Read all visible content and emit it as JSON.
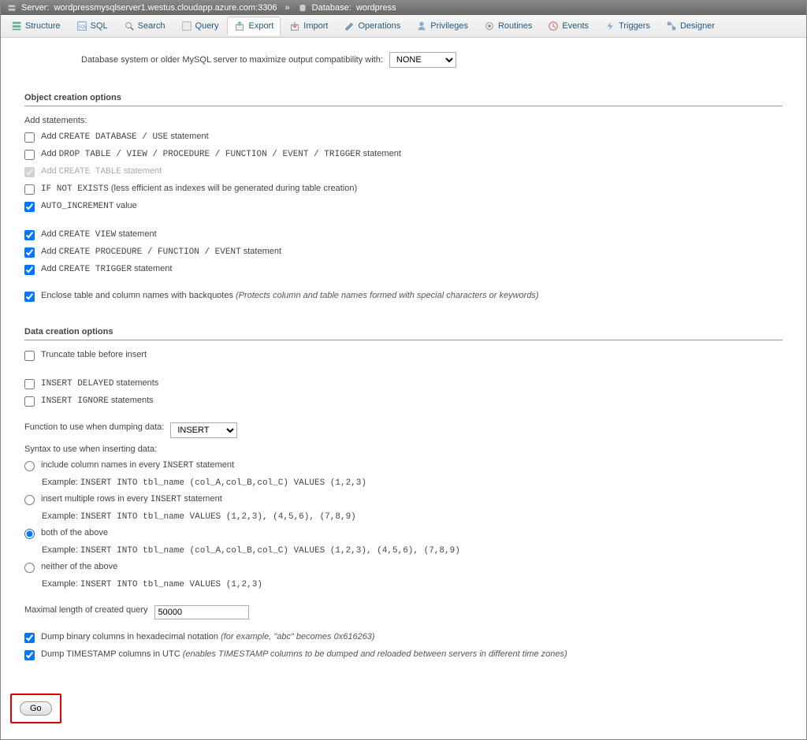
{
  "titlebar": {
    "server_label": "Server:",
    "server_value": "wordpressmysqlserver1.westus.cloudapp.azure.com:3306",
    "db_label": "Database:",
    "db_value": "wordpress"
  },
  "menu": {
    "structure": "Structure",
    "sql": "SQL",
    "search": "Search",
    "query": "Query",
    "export": "Export",
    "import": "Import",
    "operations": "Operations",
    "privileges": "Privileges",
    "routines": "Routines",
    "events": "Events",
    "triggers": "Triggers",
    "designer": "Designer"
  },
  "compat": {
    "label": "Database system or older MySQL server to maximize output compatibility with:",
    "value": "NONE"
  },
  "sections": {
    "object": "Object creation options",
    "data": "Data creation options"
  },
  "object": {
    "add_statements": "Add statements:",
    "create_db_pre": "Add ",
    "create_db_code": "CREATE DATABASE / USE",
    "create_db_post": " statement",
    "drop_pre": "Add ",
    "drop_code": "DROP TABLE / VIEW / PROCEDURE / FUNCTION / EVENT / TRIGGER",
    "drop_post": " statement",
    "create_table_pre": "Add ",
    "create_table_code": "CREATE TABLE",
    "create_table_post": " statement",
    "ifnotexists_code": "IF NOT EXISTS",
    "ifnotexists_post": " (less efficient as indexes will be generated during table creation)",
    "autoinc_code": "AUTO_INCREMENT",
    "autoinc_post": " value",
    "create_view_pre": "Add ",
    "create_view_code": "CREATE VIEW",
    "create_view_post": " statement",
    "create_proc_pre": "Add ",
    "create_proc_code": "CREATE PROCEDURE / FUNCTION / EVENT",
    "create_proc_post": " statement",
    "create_trig_pre": "Add ",
    "create_trig_code": "CREATE TRIGGER",
    "create_trig_post": " statement",
    "backquotes": "Enclose table and column names with backquotes ",
    "backquotes_note": "(Protects column and table names formed with special characters or keywords)"
  },
  "data": {
    "truncate": "Truncate table before insert",
    "delayed_code": "INSERT DELAYED",
    "delayed_post": " statements",
    "ignore_code": "INSERT IGNORE",
    "ignore_post": " statements",
    "func_label": "Function to use when dumping data:",
    "func_value": "INSERT",
    "syntax_label": "Syntax to use when inserting data:",
    "opt1_label": "include column names in every ",
    "opt1_code": "INSERT",
    "opt1_post": " statement",
    "opt1_ex_label": "Example: ",
    "opt1_ex": "INSERT INTO tbl_name (col_A,col_B,col_C) VALUES (1,2,3)",
    "opt2_label": "insert multiple rows in every ",
    "opt2_code": "INSERT",
    "opt2_post": " statement",
    "opt2_ex_label": "Example: ",
    "opt2_ex": "INSERT INTO tbl_name VALUES (1,2,3), (4,5,6), (7,8,9)",
    "opt3_label": "both of the above",
    "opt3_ex_label": "Example: ",
    "opt3_ex": "INSERT INTO tbl_name (col_A,col_B,col_C) VALUES (1,2,3), (4,5,6), (7,8,9)",
    "opt4_label": "neither of the above",
    "opt4_ex_label": "Example: ",
    "opt4_ex": "INSERT INTO tbl_name VALUES (1,2,3)",
    "maxlen_label": "Maximal length of created query",
    "maxlen_value": "50000",
    "hex_label": "Dump binary columns in hexadecimal notation ",
    "hex_note": "(for example, \"abc\" becomes 0x616263)",
    "utc_label": "Dump TIMESTAMP columns in UTC ",
    "utc_note": "(enables TIMESTAMP columns to be dumped and reloaded between servers in different time zones)"
  },
  "go": "Go"
}
